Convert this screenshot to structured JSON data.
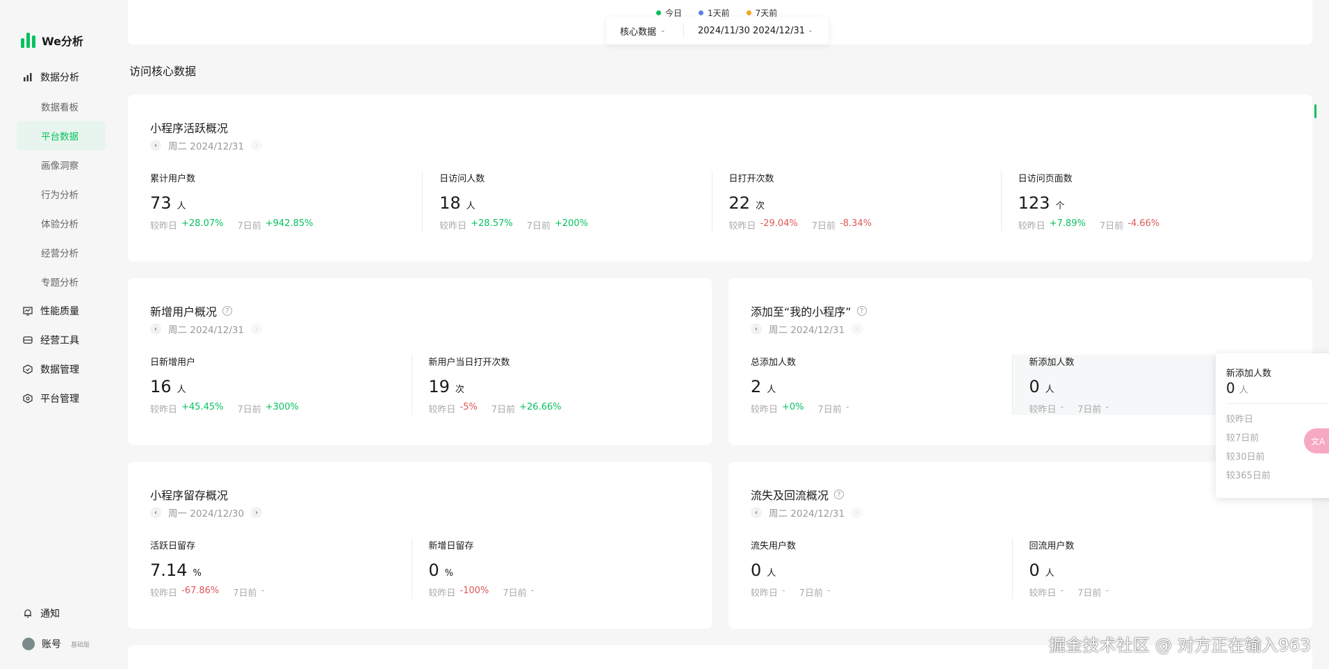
{
  "brand": {
    "name": "We分析",
    "color": "#07c160"
  },
  "sidebar": {
    "sections": [
      {
        "label": "数据分析",
        "icon": "bar-chart-icon"
      },
      {
        "label": "性能质量",
        "icon": "monitor-icon"
      },
      {
        "label": "经营工具",
        "icon": "wallet-icon"
      },
      {
        "label": "数据管理",
        "icon": "database-icon"
      },
      {
        "label": "平台管理",
        "icon": "settings-icon"
      }
    ],
    "subitems": [
      "数据看板",
      "平台数据",
      "画像洞察",
      "行为分析",
      "体验分析",
      "经营分析",
      "专题分析"
    ],
    "active_subitem": "平台数据",
    "bottom": {
      "notify": "通知",
      "account": "账号",
      "account_badge": "基础版"
    }
  },
  "legend": [
    {
      "label": "今日",
      "color": "#07c160"
    },
    {
      "label": "1天前",
      "color": "#5b7fe8"
    },
    {
      "label": "7天前",
      "color": "#f5a623"
    }
  ],
  "filter": {
    "type": "核心数据",
    "date_range": "2024/11/30 2024/12/31"
  },
  "section_title": "访问核心数据",
  "cards": {
    "active": {
      "title": "小程序活跃概况",
      "date": "周二 2024/12/31",
      "metrics": [
        {
          "label": "累计用户数",
          "value": "73",
          "unit": "人",
          "d1_label": "较昨日",
          "d1": "+28.07%",
          "d7_label": "7日前",
          "d7": "+942.85%"
        },
        {
          "label": "日访问人数",
          "value": "18",
          "unit": "人",
          "d1_label": "较昨日",
          "d1": "+28.57%",
          "d7_label": "7日前",
          "d7": "+200%"
        },
        {
          "label": "日打开次数",
          "value": "22",
          "unit": "次",
          "d1_label": "较昨日",
          "d1": "-29.04%",
          "d7_label": "7日前",
          "d7": "-8.34%"
        },
        {
          "label": "日访问页面数",
          "value": "123",
          "unit": "个",
          "d1_label": "较昨日",
          "d1": "+7.89%",
          "d7_label": "7日前",
          "d7": "-4.66%"
        }
      ]
    },
    "new_users": {
      "title": "新增用户概况",
      "date": "周二 2024/12/31",
      "metrics": [
        {
          "label": "日新增用户",
          "value": "16",
          "unit": "人",
          "d1_label": "较昨日",
          "d1": "+45.45%",
          "d7_label": "7日前",
          "d7": "+300%"
        },
        {
          "label": "新用户当日打开次数",
          "value": "19",
          "unit": "次",
          "d1_label": "较昨日",
          "d1": "-5%",
          "d7_label": "7日前",
          "d7": "+26.66%"
        }
      ]
    },
    "add_mine": {
      "title": "添加至“我的小程序”",
      "date": "周二 2024/12/31",
      "metrics": [
        {
          "label": "总添加人数",
          "value": "2",
          "unit": "人",
          "d1_label": "较昨日",
          "d1": "+0%",
          "d7_label": "7日前",
          "d7": "-"
        },
        {
          "label": "新添加人数",
          "value": "0",
          "unit": "人",
          "d1_label": "较昨日",
          "d1": "-",
          "d7_label": "7日前",
          "d7": "-"
        }
      ]
    },
    "retention": {
      "title": "小程序留存概况",
      "date": "周一 2024/12/30",
      "metrics": [
        {
          "label": "活跃日留存",
          "value": "7.14",
          "unit": "%",
          "d1_label": "较昨日",
          "d1": "-67.86%",
          "d7_label": "7日前",
          "d7": "-"
        },
        {
          "label": "新增日留存",
          "value": "0",
          "unit": "%",
          "d1_label": "较昨日",
          "d1": "-100%",
          "d7_label": "7日前",
          "d7": "-"
        }
      ]
    },
    "churn": {
      "title": "流失及回流概况",
      "date": "周二 2024/12/31",
      "metrics": [
        {
          "label": "流失用户数",
          "value": "0",
          "unit": "人",
          "d1_label": "较昨日",
          "d1": "-",
          "d7_label": "7日前",
          "d7": "-"
        },
        {
          "label": "回流用户数",
          "value": "0",
          "unit": "人",
          "d1_label": "较昨日",
          "d1": "-",
          "d7_label": "7日前",
          "d7": "-"
        }
      ]
    }
  },
  "popup": {
    "title": "新添加人数",
    "value": "0",
    "unit": "人",
    "rows": [
      "较昨日",
      "较7日前",
      "较30日前",
      "较365日前"
    ]
  },
  "watermark": "掘金技术社区 @ 对方正在输入963"
}
